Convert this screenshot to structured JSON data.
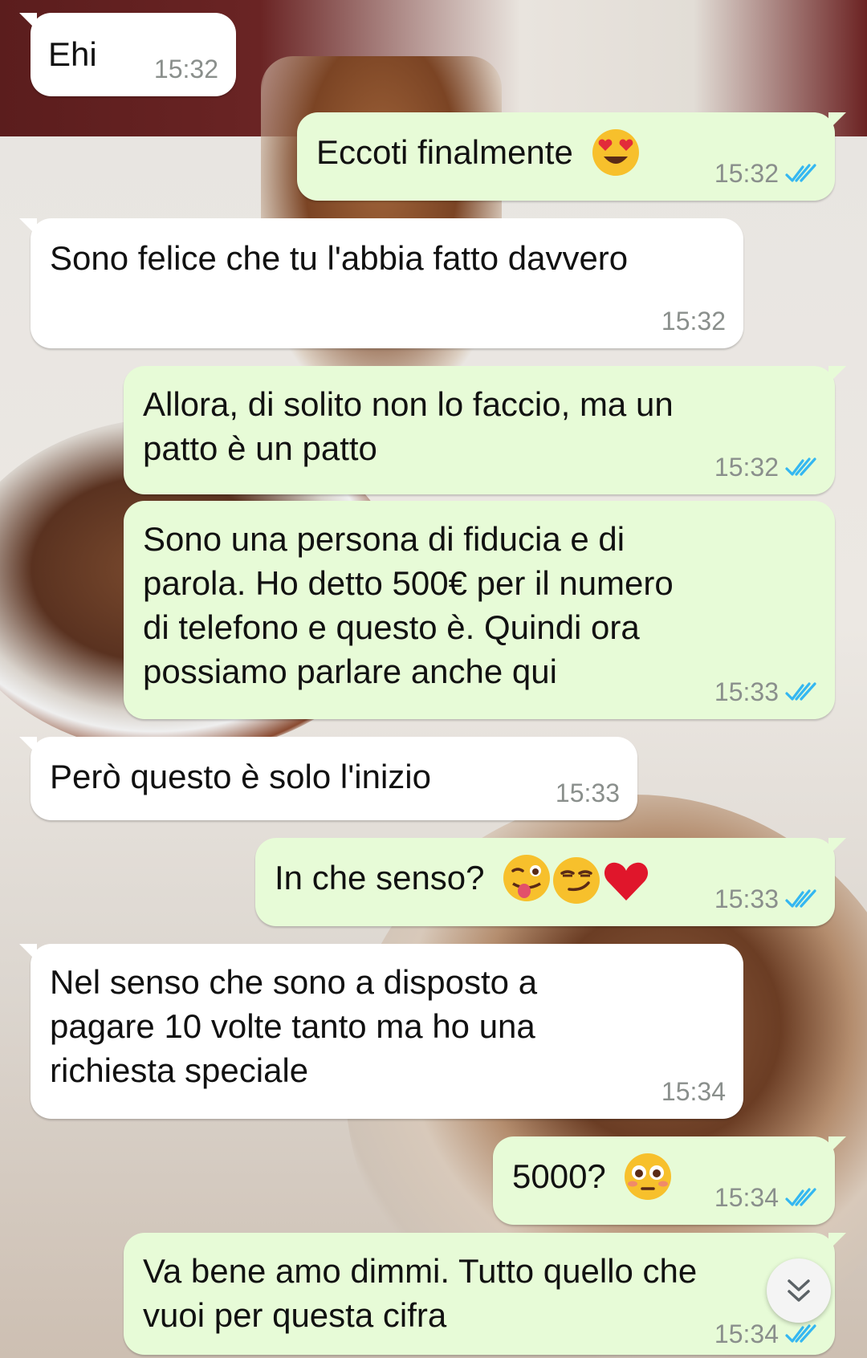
{
  "messages": [
    {
      "text": "Ehi",
      "time": "15:32"
    },
    {
      "text": "Eccoti finalmente",
      "time": "15:32"
    },
    {
      "text": "Sono felice che tu l'abbia fatto davvero",
      "time": "15:32"
    },
    {
      "text": "Allora, di solito non lo faccio, ma un\npatto è un patto",
      "time": "15:32"
    },
    {
      "text": "Sono una persona di fiducia e di\nparola. Ho detto 500€ per il numero\ndi telefono e questo è. Quindi ora\npossiamo parlare anche qui",
      "time": "15:33"
    },
    {
      "text": "Però questo è solo l'inizio",
      "time": "15:33"
    },
    {
      "text": "In che senso?",
      "time": "15:33"
    },
    {
      "text": "Nel senso che sono a disposto a\npagare 10 volte tanto ma ho una\nrichiesta speciale",
      "time": "15:34"
    },
    {
      "text": "5000?",
      "time": "15:34"
    },
    {
      "text": "Va bene amo dimmi. Tutto quello che\nvuoi per questa cifra",
      "time": "15:34"
    }
  ],
  "icons": {
    "read_receipt": "double-check-icon",
    "scroll_down": "chevron-double-down-icon",
    "emoji_heart_eyes": "heart-eyes-emoji",
    "emoji_wink_tongue": "winking-tongue-emoji",
    "emoji_smirk": "smirk-emoji",
    "emoji_heart": "red-heart-emoji",
    "emoji_flushed": "flushed-emoji"
  },
  "colors": {
    "incoming_bubble": "#ffffff",
    "outgoing_bubble": "#e7fbd7",
    "timestamp": "#8a8f8c",
    "read_ticks": "#34b7f1"
  }
}
